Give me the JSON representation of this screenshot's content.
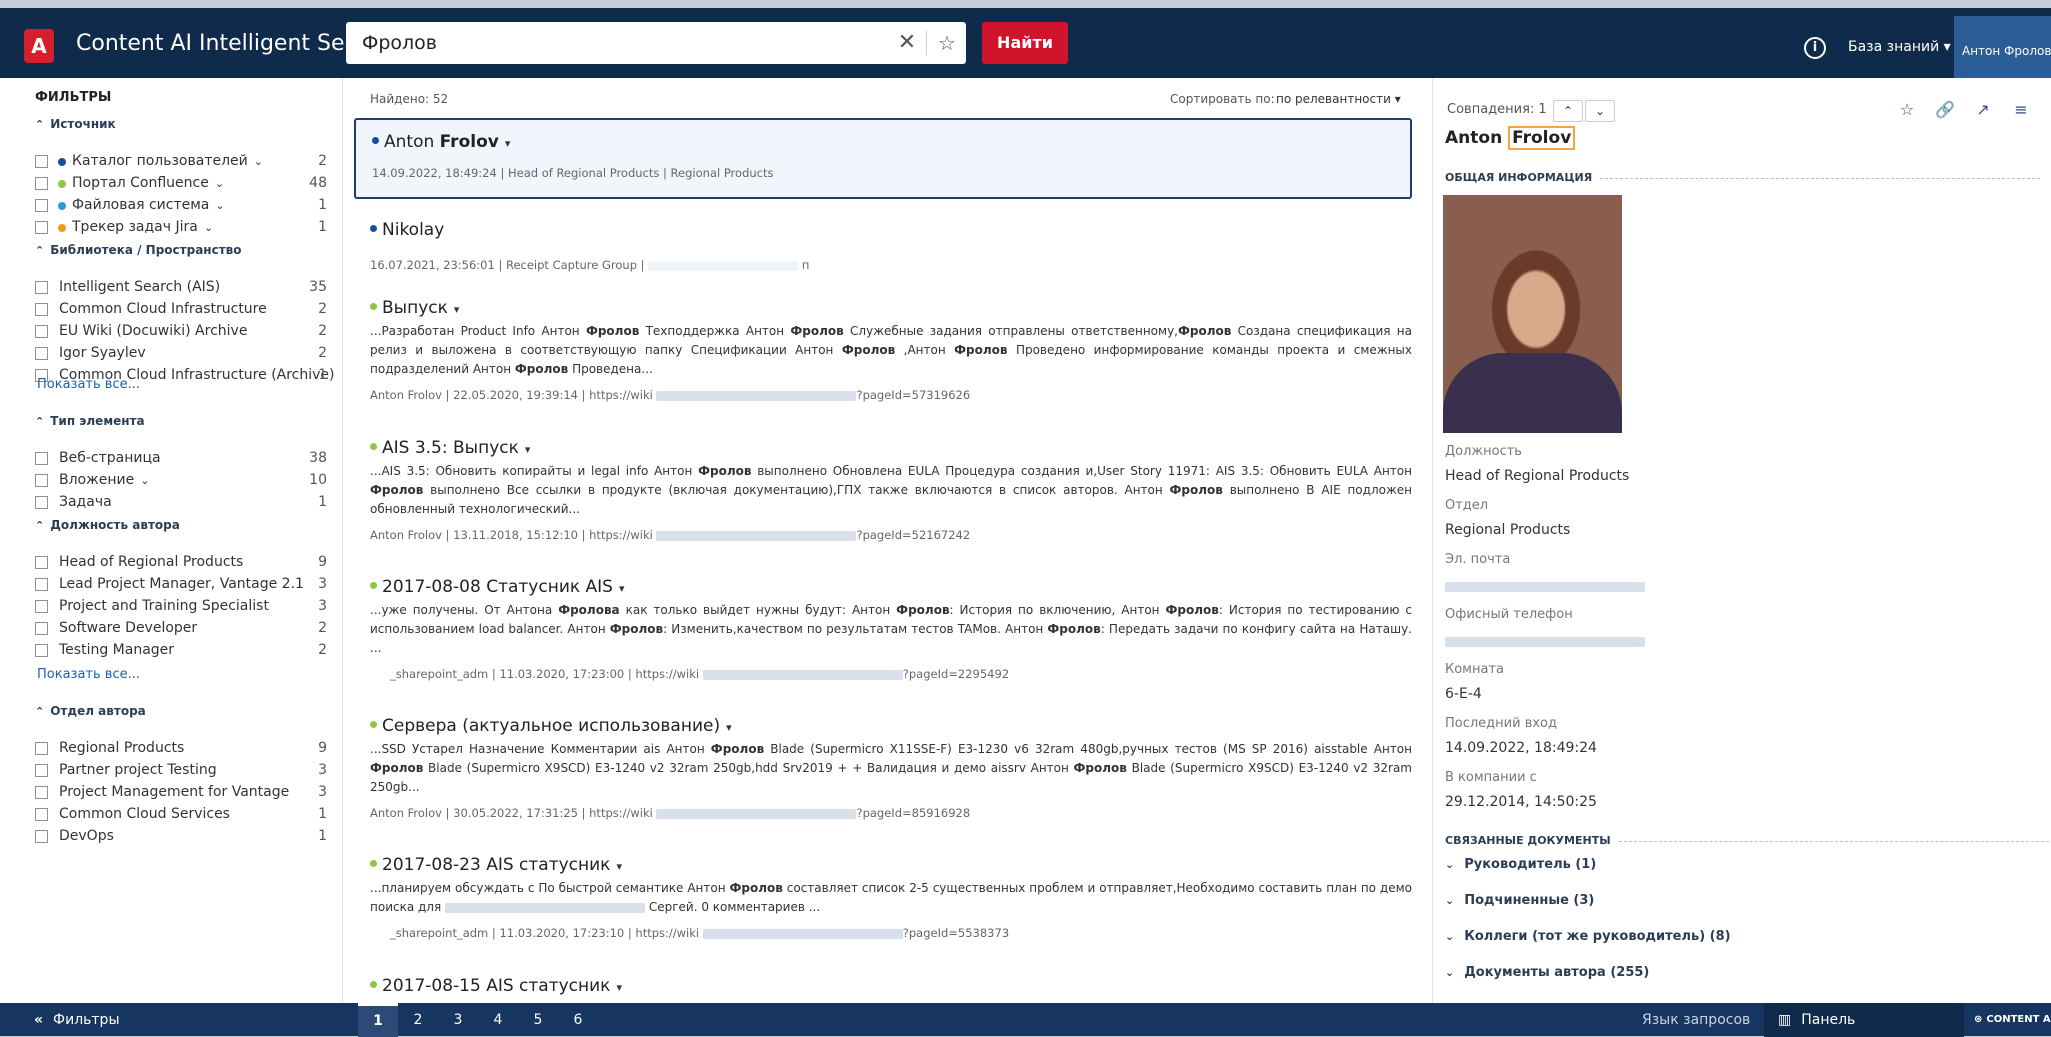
{
  "header": {
    "logo": "A",
    "app_title": "Content AI Intelligent Search",
    "search_value": "Фролов",
    "search_button": "Найти",
    "kb_menu": "База знаний ▾",
    "user_name": "Антон Фролов"
  },
  "filters": {
    "title": "ФИЛЬТРЫ",
    "show_all": "Показать все...",
    "groups": [
      {
        "name": "Источник",
        "items": [
          {
            "label": "Каталог пользователей",
            "count": "2",
            "color": "#1c4c9c"
          },
          {
            "label": "Портал Confluence",
            "count": "48",
            "color": "#8dc63f"
          },
          {
            "label": "Файловая система",
            "count": "1",
            "color": "#2a9ad8"
          },
          {
            "label": "Трекер задач Jira",
            "count": "1",
            "color": "#f39a1d"
          }
        ]
      },
      {
        "name": "Библиотека / Пространство",
        "items": [
          {
            "label": "Intelligent Search (AIS)",
            "count": "35"
          },
          {
            "label": "Common Cloud Infrastructure",
            "count": "2"
          },
          {
            "label": "EU Wiki (Docuwiki) Archive",
            "count": "2"
          },
          {
            "label": "Igor Syaylev",
            "count": "2"
          },
          {
            "label": "Common Cloud Infrastructure (Archive)",
            "count": "1"
          }
        ]
      },
      {
        "name": "Тип элемента",
        "items": [
          {
            "label": "Веб-страница",
            "count": "38"
          },
          {
            "label": "Вложение",
            "count": "10"
          },
          {
            "label": "Задача",
            "count": "1"
          }
        ]
      },
      {
        "name": "Должность автора",
        "items": [
          {
            "label": "Head of Regional Products",
            "count": "9"
          },
          {
            "label": "Lead Project Manager, Vantage 2.1",
            "count": "3"
          },
          {
            "label": "Project and Training Specialist",
            "count": "3"
          },
          {
            "label": "Software Developer",
            "count": "2"
          },
          {
            "label": "Testing Manager",
            "count": "2"
          }
        ]
      },
      {
        "name": "Отдел автора",
        "items": [
          {
            "label": "Regional Products",
            "count": "9"
          },
          {
            "label": "Partner project Testing",
            "count": "3"
          },
          {
            "label": "Project Management for Vantage",
            "count": "3"
          },
          {
            "label": "Common Cloud Services",
            "count": "1"
          },
          {
            "label": "DevOps",
            "count": "1"
          }
        ]
      }
    ]
  },
  "results": {
    "found": "Найдено: 52",
    "sort_label": "Сортировать по:",
    "sort_value": "по релевантности ▾",
    "r1": {
      "title_a": "Anton ",
      "title_b": "Frolov",
      "meta": "14.09.2022, 18:49:24 | Head of Regional Products | Regional Products"
    },
    "r2": {
      "title": "Nikolay",
      "meta": "16.07.2021, 23:56:01 | Receipt Capture Group |",
      "meta_tail": "п"
    },
    "r3": {
      "title": "Выпуск",
      "s1": "...Разработан Product Info Антон ",
      "s2": "Фролов",
      "s3": " Техподдержка Антон ",
      "s4": "Фролов",
      "s5": " Служебные задания отправлены ответственному,",
      "s6": "Фролов",
      "s7": " Создана спецификация на релиз и выложена в соответствующую папку Спецификации Антон ",
      "s8": "Фролов",
      "s9": " ,Антон ",
      "s10": "Фролов",
      "s11": " Проведено информирование команды проекта и смежных подразделений Антон ",
      "s12": "Фролов",
      "s13": " Проведена...",
      "meta": "Anton Frolov | 22.05.2020, 19:39:14 | https://wiki",
      "meta_tail": "?pageId=57319626"
    },
    "r4": {
      "title": "AIS 3.5: Выпуск",
      "s1": "...AIS 3.5: Обновить копирайты и legal info Антон ",
      "s2": "Фролов",
      "s3": " выполнено Обновлена EULA Процедура создания и,User Story 11971: AIS 3.5: Обновить EULA Антон ",
      "s4": "Фролов",
      "s5": " выполнено Все ссылки в продукте (включая документацию),ГПХ также включаются в список авторов. Антон ",
      "s6": "Фролов",
      "s7": " выполнено В AIE подложен обновленный технологический...",
      "meta": "Anton Frolov | 13.11.2018, 15:12:10 | https://wiki",
      "meta_tail": "?pageId=52167242"
    },
    "r5": {
      "title": "2017-08-08 Статусник AIS",
      "s1": "...уже получены. От Антона ",
      "s2": "Фролова",
      "s3": " как только выйдет нужны будут: Антон ",
      "s4": "Фролов",
      "s5": ": История по включению, Антон ",
      "s6": "Фролов",
      "s7": ": История по тестированию с использованием load balancer.   Антон ",
      "s8": "Фролов",
      "s9": ": Изменить,качеством по результатам тестов TAMов.   Антон ",
      "s10": "Фролов",
      "s11": ": Передать задачи по конфигу сайта на Наташу.  ...",
      "meta": "_sharepoint_adm | 11.03.2020, 17:23:00 | https://wiki",
      "meta_tail": "?pageId=2295492"
    },
    "r6": {
      "title": "Сервера (актуальное использование)",
      "s1": "...SSD Устарел Назначение Комментарии ais Антон ",
      "s2": "Фролов",
      "s3": " Blade (Supermicro X11SSE-F) E3-1230 v6 32ram 480gb,ручных тестов (MS SP 2016) aisstable Антон ",
      "s4": "Фролов",
      "s5": " Blade (Supermicro X9SCD) E3-1240 v2 32ram 250gb,hdd Srv2019 + + Валидация и демо aissrv Антон ",
      "s6": "Фролов",
      "s7": " Blade (Supermicro X9SCD) E3-1240 v2 32ram 250gb...",
      "meta": "Anton Frolov | 30.05.2022, 17:31:25 | https://wiki",
      "meta_tail": "?pageId=85916928"
    },
    "r7": {
      "title": "2017-08-23 AIS статусник",
      "s1": "...планируем обсуждать с  По быстрой семантике Антон ",
      "s2": "Фролов",
      "s3": " составляет список 2-5 существенных проблем и отправляет,Необходимо составить план по демо поиска для",
      "s4": "Сергей.  0 комментариев ...",
      "meta": "_sharepoint_adm | 11.03.2020, 17:23:10 | https://wiki",
      "meta_tail": "?pageId=5538373"
    },
    "r8": {
      "title": "2017-08-15 AIS статусник"
    }
  },
  "preview": {
    "matches": "Совпадения: 1",
    "name_a": "Anton ",
    "name_b": "Frolov",
    "section_general": "ОБЩАЯ ИНФОРМАЦИЯ",
    "fields": [
      {
        "label": "Должность",
        "value": "Head of Regional Products"
      },
      {
        "label": "Отдел",
        "value": "Regional Products"
      },
      {
        "label": "Эл. почта",
        "value": ""
      },
      {
        "label": "Офисный телефон",
        "value": ""
      },
      {
        "label": "Комната",
        "value": "6-E-4"
      },
      {
        "label": "Последний вход",
        "value": "14.09.2022, 18:49:24"
      },
      {
        "label": "В компании с",
        "value": "29.12.2014, 14:50:25"
      }
    ],
    "section_related": "СВЯЗАННЫЕ ДОКУМЕНТЫ",
    "related": [
      "Руководитель (1)",
      "Подчиненные (3)",
      "Коллеги (тот же руководитель) (8)",
      "Документы автора (255)"
    ]
  },
  "footer": {
    "filters": "Фильтры",
    "pages": [
      "1",
      "2",
      "3",
      "4",
      "5",
      "6"
    ],
    "query_lang": "Язык запросов",
    "preview_panel": "Панель предпросмотра",
    "brand": "CONTENT AI"
  }
}
